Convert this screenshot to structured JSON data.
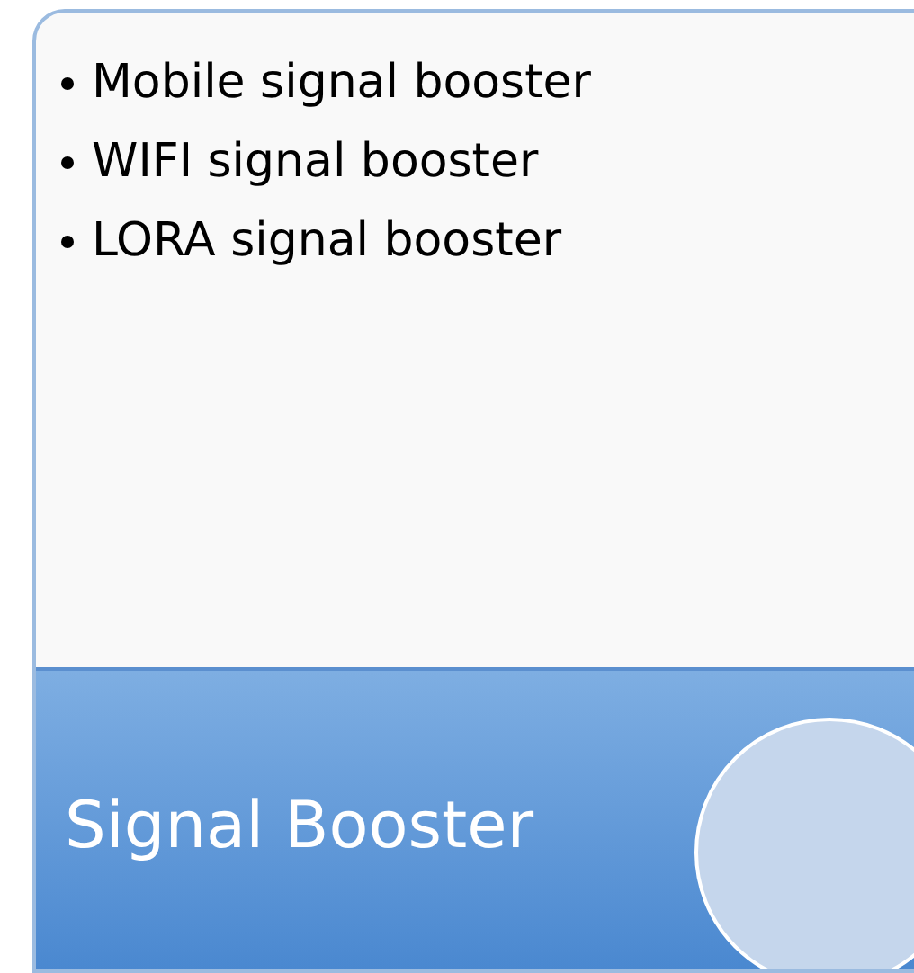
{
  "card": {
    "bullets": [
      "Mobile signal booster",
      "WIFI signal booster",
      "LORA signal booster"
    ],
    "title": "Signal Booster"
  }
}
